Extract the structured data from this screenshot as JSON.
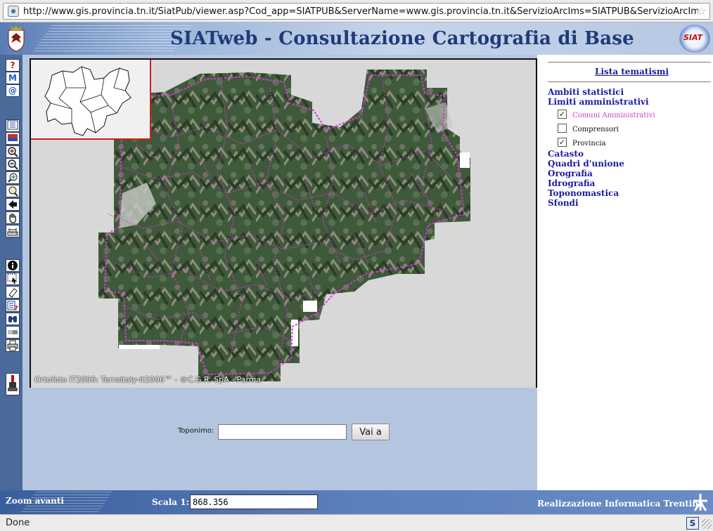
{
  "browser": {
    "url": "http://www.gis.provincia.tn.it/SiatPub/viewer.asp?Cod_app=SIATPUB&ServerName=www.gis.provincia.tn.it&ServizioArcIms=SIATPUB&ServizioArcImsC",
    "status": "Done"
  },
  "header": {
    "title": "SIATweb - Consultazione Cartografia di Base",
    "logo_text": "SIAT"
  },
  "toolbar": {
    "groups": [
      [
        "help-icon",
        "m-icon",
        "email-icon"
      ],
      [
        "legend-icon",
        "layers-icon",
        "zoom-in-icon",
        "zoom-out-icon",
        "zoom-full-icon",
        "zoom-layer-icon",
        "back-icon",
        "pan-icon",
        "measure-icon"
      ],
      [
        "identify-icon",
        "select-icon",
        "clear-icon",
        "query-icon",
        "find-icon",
        "buffer-icon",
        "print-icon"
      ],
      [
        "tool-icon"
      ]
    ]
  },
  "map": {
    "copyright": "Ortofoto IT2006: Terraitaly-It2006™ - ©C.G.R. SpA - Parma"
  },
  "panel": {
    "title": "Lista tematismi",
    "categories_a": [
      "Ambiti statistici",
      "Limiti amministrativi"
    ],
    "layers": [
      {
        "label": "Comuni Amministrativi",
        "checked": true
      },
      {
        "label": "Comprensori",
        "checked": false
      },
      {
        "label": "Provincia",
        "checked": true
      }
    ],
    "categories_b": [
      "Catasto",
      "Quadri d'unione",
      "Orografia",
      "Idrografia",
      "Toponomastica",
      "Sfondi"
    ]
  },
  "search": {
    "label": "Toponimo:",
    "value": "",
    "button": "Vai a"
  },
  "footer": {
    "tool_status": "Zoom avanti",
    "scale_label": "Scala 1:",
    "scale_value": "868.356",
    "credit": "Realizzazione Informatica Trentina"
  },
  "colors": {
    "header_title": "#1f3a78",
    "panel_link": "#1b1b9e",
    "active_layer": "#d23ad2",
    "overview_border": "#d51c1c",
    "map_boundaries": "#d63ad6"
  }
}
